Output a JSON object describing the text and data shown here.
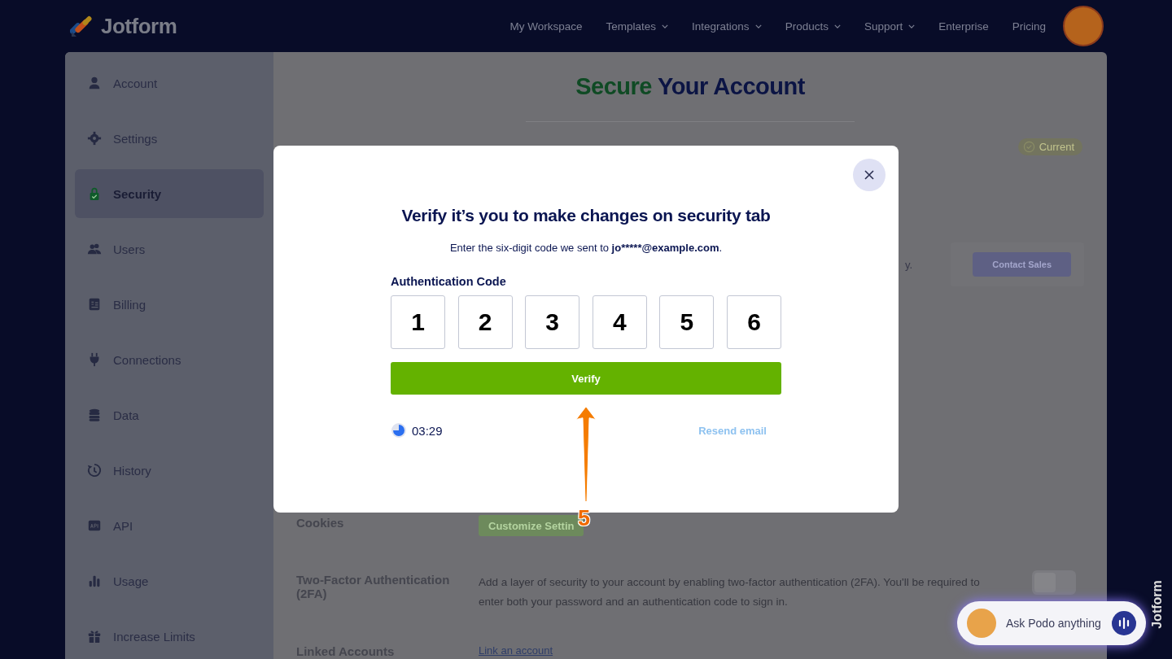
{
  "brand": {
    "name": "Jotform"
  },
  "nav": [
    {
      "label": "My Workspace",
      "dropdown": false
    },
    {
      "label": "Templates",
      "dropdown": true
    },
    {
      "label": "Integrations",
      "dropdown": true
    },
    {
      "label": "Products",
      "dropdown": true
    },
    {
      "label": "Support",
      "dropdown": true
    },
    {
      "label": "Enterprise",
      "dropdown": false
    },
    {
      "label": "Pricing",
      "dropdown": false
    }
  ],
  "sidebar": {
    "items": [
      {
        "label": "Account",
        "kind": "account",
        "selected": false
      },
      {
        "label": "Settings",
        "kind": "settings",
        "selected": false
      },
      {
        "label": "Security",
        "kind": "security",
        "selected": true
      },
      {
        "label": "Users",
        "kind": "users",
        "selected": false
      },
      {
        "label": "Billing",
        "kind": "billing",
        "selected": false
      },
      {
        "label": "Connections",
        "kind": "connections",
        "selected": false
      },
      {
        "label": "Data",
        "kind": "data",
        "selected": false
      },
      {
        "label": "History",
        "kind": "history",
        "selected": false
      },
      {
        "label": "API",
        "kind": "api",
        "selected": false
      },
      {
        "label": "Usage",
        "kind": "usage",
        "selected": false
      },
      {
        "label": "Increase Limits",
        "kind": "limits",
        "selected": false
      }
    ]
  },
  "page": {
    "title_accent": "Secure",
    "title_rest": "Your Account",
    "current_badge": "Current",
    "partial_text": "y.",
    "contact_button": "Contact Sales",
    "rows": [
      {
        "label": "Cookies",
        "kind": "button",
        "action": "Customize Settin"
      },
      {
        "label": "Two-Factor Authentication (2FA)",
        "kind": "toggle",
        "description": "Add a layer of security to your account by enabling two-factor authentication (2FA). You'll be required to enter both your password and an authentication code to sign in.",
        "on": false
      },
      {
        "label": "Linked Accounts",
        "kind": "link",
        "action": "Link an account"
      }
    ]
  },
  "modal": {
    "title": "Verify it’s you to make changes on security tab",
    "message": "Enter the six-digit code we sent to",
    "email": "jo*****@example.com",
    "message_end": ".",
    "code_label": "Authentication Code",
    "digits": [
      "1",
      "2",
      "3",
      "4",
      "5",
      "6"
    ],
    "verify_button": "Verify",
    "timer": "03:29",
    "resend_link": "Resend email"
  },
  "annotation": {
    "step": "5"
  },
  "chat": {
    "placeholder": "Ask Podo anything"
  },
  "side_tab": {
    "label": "Jotform"
  }
}
